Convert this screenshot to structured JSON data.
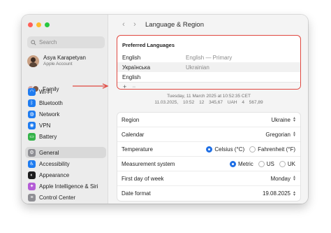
{
  "window": {
    "title": "Language & Region"
  },
  "sidebar": {
    "search_placeholder": "Search",
    "account": {
      "name": "Asya Karapetyan",
      "subtitle": "Apple Account"
    },
    "family_label": "Family",
    "groups": [
      [
        {
          "label": "Wi-Fi",
          "icon": "wifi-icon",
          "color": "#1f7cf0",
          "glyph": "◠"
        },
        {
          "label": "Bluetooth",
          "icon": "bluetooth-icon",
          "color": "#1f7cf0",
          "glyph": "ᛒ"
        },
        {
          "label": "Network",
          "icon": "globe-icon",
          "color": "#1f7cf0",
          "glyph": "◍"
        },
        {
          "label": "VPN",
          "icon": "vpn-icon",
          "color": "#1f7cf0",
          "glyph": "◉"
        },
        {
          "label": "Battery",
          "icon": "battery-icon",
          "color": "#35b34a",
          "glyph": "▭"
        }
      ],
      [
        {
          "label": "General",
          "icon": "gear-icon",
          "color": "#8e8e93",
          "glyph": "⚙",
          "selected": true
        },
        {
          "label": "Accessibility",
          "icon": "accessibility-icon",
          "color": "#1f7cf0",
          "glyph": "♿"
        },
        {
          "label": "Appearance",
          "icon": "appearance-icon",
          "color": "#1c1c1e",
          "glyph": "◐"
        },
        {
          "label": "Apple Intelligence & Siri",
          "icon": "siri-icon",
          "color": "#b45cd6",
          "glyph": "✦"
        },
        {
          "label": "Control Center",
          "icon": "control-center-icon",
          "color": "#8e8e93",
          "glyph": "≡"
        }
      ]
    ]
  },
  "preferred_languages": {
    "title": "Preferred Languages",
    "rows": [
      {
        "language": "English",
        "native": "English — Primary"
      },
      {
        "language": "Українська",
        "native": "Ukrainian"
      },
      {
        "language": "English",
        "native": ""
      }
    ],
    "add_label": "+",
    "remove_label": "−"
  },
  "preview": {
    "line1": "Tuesday, 11 March 2025 at 10:52:35 CET",
    "line2": "11.03.2025, 10:52   12 345,67 UAH   4 567,89"
  },
  "settings": {
    "region": {
      "label": "Region",
      "value": "Ukraine"
    },
    "calendar": {
      "label": "Calendar",
      "value": "Gregorian"
    },
    "temperature": {
      "label": "Temperature",
      "options": [
        "Celsius (°C)",
        "Fahrenheit (°F)"
      ],
      "selected": 0
    },
    "measurement": {
      "label": "Measurement system",
      "options": [
        "Metric",
        "US",
        "UK"
      ],
      "selected": 0
    },
    "first_day": {
      "label": "First day of week",
      "value": "Monday"
    },
    "date_format": {
      "label": "Date format",
      "value": "19.08.2025"
    }
  },
  "colors": {
    "highlight_border": "#e0473f",
    "accent": "#1f6fe5"
  }
}
